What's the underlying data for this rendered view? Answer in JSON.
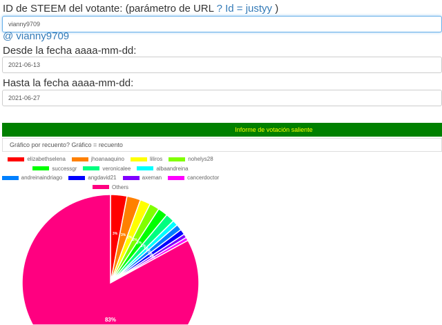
{
  "form": {
    "voter_label": "ID de STEEM del votante: (parámetro de URL ",
    "voter_link": "? Id = justyy",
    "voter_close": " )",
    "voter_value": "vianny9709",
    "user_link": "@ vianny9709",
    "from_label": "Desde la fecha aaaa-mm-dd:",
    "from_value": "2021-06-13",
    "to_label": "Hasta la fecha aaaa-mm-dd:",
    "to_value": "2021-06-27",
    "report_button": "Informe de votación saliente",
    "chart_select": "Gráfico por recuento? Gráfico = recuento"
  },
  "chart_data": {
    "type": "pie",
    "labels": [
      "elizabethselena",
      "jhoanaaquino",
      "liliros",
      "nohelys28",
      "successgr",
      "veronicalee",
      "albaandreina",
      "andreinaindriago",
      "angdavid21",
      "axeman",
      "cancerdoctor",
      "Others"
    ],
    "values": [
      3,
      2.5,
      1.9,
      1.8,
      1.8,
      1.6,
      1,
      1.1,
      1,
      0.7,
      0.6,
      83
    ],
    "colors": [
      "#ff0000",
      "#ff8000",
      "#ffff00",
      "#80ff00",
      "#00ff00",
      "#00ff80",
      "#00ffff",
      "#0080ff",
      "#0000ff",
      "#8000ff",
      "#ff00ff",
      "#ff0080"
    ],
    "legend_position": "top"
  }
}
